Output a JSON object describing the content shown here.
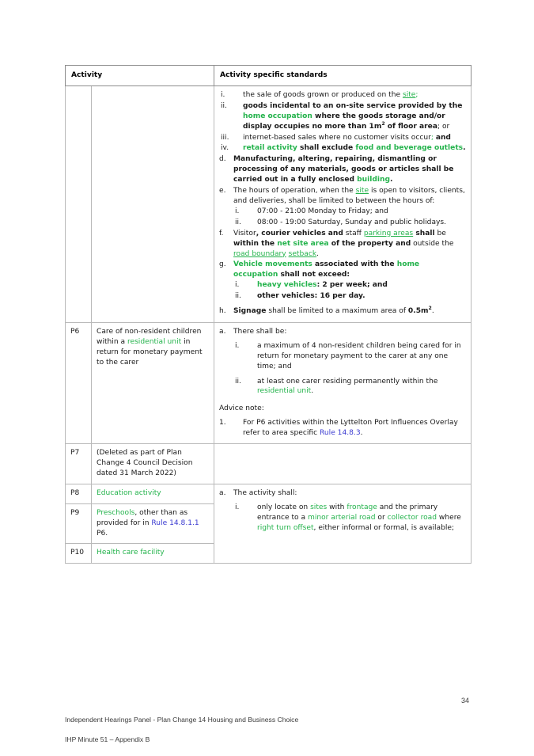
{
  "document": {
    "page_number": "34",
    "footer_line_1": "Independent Hearings Panel - Plan Change 14 Housing and Business Choice",
    "footer_line_2": "IHP Minute 51 – Appendix B"
  },
  "colors": {
    "defined_term_green": "#24b34c",
    "rule_link_blue": "#3a3ad0",
    "table_border": "#b9b9b9",
    "text": "#1a1a1a"
  },
  "table": {
    "headers": {
      "activity": "Activity",
      "standards": "Activity specific standards"
    },
    "rows": [
      {
        "code": "",
        "description": "",
        "standards_plain": "i. the sale of goods grown or produced on the site; ii. goods incidental to an on-site service provided by the home occupation where the goods storage and/or display occupies no more than 1m2 of floor area; or iii. internet-based sales where no customer visits occur; and iv. retail activity shall exclude food and beverage outlets. d. Manufacturing, altering, repairing, dismantling or processing of any materials, goods or articles shall be carried out in a fully enclosed building. e. The hours of operation, when the site is open to visitors, clients, and deliveries, shall be limited to between the hours of: i. 07:00 - 21:00 Monday to Friday; and ii. 08:00 - 19:00 Saturday, Sunday and public holidays. f. Visitor, courier vehicles and staff parking areas shall be within the net site area of the property and outside the road boundary setback. g. Vehicle movements associated with the home occupation shall not exceed: i. heavy vehicles: 2 per week; and ii. other vehicles: 16 per day. h. Signage shall be limited to a maximum area of 0.5m2.",
        "markers": {
          "i": "i.",
          "ii": "ii.",
          "iii": "iii.",
          "iv": "iv.",
          "d": "d.",
          "e": "e.",
          "f": "f.",
          "g": "g.",
          "h": "h."
        },
        "items": {
          "i_text_a": "the sale of goods grown or produced on the ",
          "i_term_site": "site",
          "i_text_b": ";",
          "ii_b1": "goods incidental to an on-site service provided by the ",
          "ii_term_home_occupation": "home occupation",
          "ii_b2": " where the goods storage and/or display occupies no more than 1m",
          "ii_sup": "2",
          "ii_b3": " of floor area",
          "ii_tail": "; or",
          "iii_text": "internet-based sales where no customer visits occur",
          "iii_semi": ";",
          "iii_and": "and",
          "iv_term_retail": "retail activity",
          "iv_mid": " shall exclude ",
          "iv_term_food": "food and beverage outlets",
          "iv_end": ".",
          "d_b1": "Manufacturing, altering, repairing, dismantling or processing of any materials, goods or articles shall be carried out in a fully enclosed ",
          "d_term_building": "building",
          "d_end": ".",
          "e_t1": "The hours of operation, when the ",
          "e_term_site": "site",
          "e_t2": " is open to visitors, clients, and deliveries, shall be limited to between the hours of:",
          "e_i": "07:00 - 21:00 Monday to Friday; and",
          "e_ii": "08:00 - 19:00 Saturday, Sunday and public holidays.",
          "f_t1": "Visitor",
          "f_b1": ", courier vehicles and",
          "f_t2": " staff ",
          "f_term_parking": "parking areas",
          "f_b2": " shall",
          "f_t3": " be ",
          "f_b3": "within the ",
          "f_term_net_site": "net site area",
          "f_b4": " of the property and",
          "f_t4": " outside the ",
          "f_term_road_boundary": "road boundary",
          "f_term_setback": "setback",
          "f_end": ".",
          "g_term_vehicle": "Vehicle movements",
          "g_mid": " associated with the ",
          "g_term_home": "home occupation",
          "g_end": " shall not exceed:",
          "g_i_term": "heavy vehicles",
          "g_i_tail": ": 2 per week; and",
          "g_ii": "other vehicles: 16 per day.",
          "h_term": "Signage",
          "h_mid": " shall be limited to a maximum area of ",
          "h_val": "0.5m",
          "h_sup": "2",
          "h_end": "."
        }
      },
      {
        "code": "P6",
        "desc_t1": "Care of non-resident children within a ",
        "desc_term": "residential unit",
        "desc_t2": " in return for monetary payment to the carer",
        "markers": {
          "a": "a.",
          "i": "i.",
          "ii": "ii.",
          "note": "1."
        },
        "a_text": "There shall be:",
        "a_i": "a maximum of 4 non-resident children being cared for in return for monetary payment to the carer at any one time; and",
        "a_ii_t1": "at least one carer residing permanently within the ",
        "a_ii_term": "residential unit",
        "a_ii_t2": ".",
        "advice_label": "Advice note:",
        "note_t1": "For P6 activities within the Lyttelton Port Influences Overlay refer to area specific ",
        "note_link": "Rule 14.8.3",
        "note_t2": "."
      },
      {
        "code": "P7",
        "description": "(Deleted as part of Plan Change 4 Council Decision dated 31 March 2022)",
        "standards": ""
      },
      {
        "code": "P8",
        "desc_term": "Education activity"
      },
      {
        "code": "P9",
        "desc_term": "Preschools",
        "desc_t1": ", other than as provided for in ",
        "desc_link": "Rule 14.8.1.1",
        "desc_t2": " P6."
      },
      {
        "code": "P10",
        "desc_term": "Health care facility"
      }
    ],
    "p8_p10_standards": {
      "markers": {
        "a": "a.",
        "i": "i."
      },
      "a_text": "The activity shall:",
      "i_t1": "only locate on ",
      "i_term_sites": "sites",
      "i_t2": " with ",
      "i_term_frontage": "frontage",
      "i_t3": " and the primary entrance to a ",
      "i_term_minor": "minor arterial road",
      "i_t4": " or ",
      "i_term_collector": "collector road",
      "i_t5": " where ",
      "i_term_rto": "right turn offset",
      "i_t6": ", either informal or formal, is available;"
    }
  }
}
